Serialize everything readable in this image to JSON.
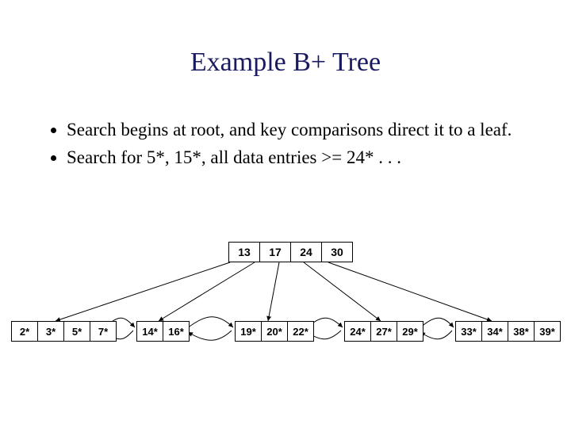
{
  "title": "Example B+ Tree",
  "bullets": [
    "Search begins at root, and key comparisons direct it to a leaf.",
    "Search for 5*, 15*, all data entries >= 24* . . ."
  ],
  "tree": {
    "root": {
      "cells": [
        "13",
        "17",
        "24",
        "30"
      ]
    },
    "leaves": [
      {
        "cells": [
          "2*",
          "3*",
          "5*",
          "7*"
        ]
      },
      {
        "cells": [
          "14*",
          "16*"
        ]
      },
      {
        "cells": [
          "19*",
          "20*",
          "22*"
        ]
      },
      {
        "cells": [
          "24*",
          "27*",
          "29*"
        ]
      },
      {
        "cells": [
          "33*",
          "34*",
          "38*",
          "39*"
        ]
      }
    ]
  }
}
